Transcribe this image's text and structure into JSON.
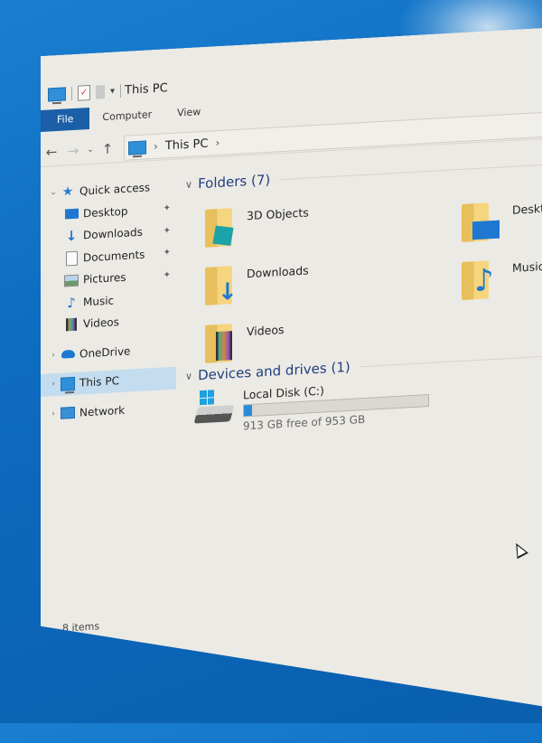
{
  "window": {
    "title": "This PC",
    "qat_dropdown_glyph": "▾"
  },
  "ribbon": {
    "tabs": [
      {
        "label": "File",
        "active": true
      },
      {
        "label": "Computer",
        "active": false
      },
      {
        "label": "View",
        "active": false
      }
    ]
  },
  "address": {
    "back_glyph": "←",
    "forward_glyph": "→",
    "recent_glyph": "⌄",
    "up_glyph": "↑",
    "sep_glyph": "›",
    "path": [
      "This PC"
    ]
  },
  "nav_pane": {
    "quick_access": {
      "label": "Quick access",
      "expanded_glyph": "⌄",
      "items": [
        {
          "label": "Desktop",
          "pinned": true,
          "icon": "desktop-icon"
        },
        {
          "label": "Downloads",
          "pinned": true,
          "icon": "downloads-icon"
        },
        {
          "label": "Documents",
          "pinned": true,
          "icon": "documents-icon"
        },
        {
          "label": "Pictures",
          "pinned": true,
          "icon": "pictures-icon"
        },
        {
          "label": "Music",
          "pinned": false,
          "icon": "music-icon"
        },
        {
          "label": "Videos",
          "pinned": false,
          "icon": "videos-icon"
        }
      ]
    },
    "roots": [
      {
        "label": "OneDrive",
        "icon": "onedrive-icon",
        "selected": false
      },
      {
        "label": "This PC",
        "icon": "this-pc-icon",
        "selected": true
      },
      {
        "label": "Network",
        "icon": "network-icon",
        "selected": false
      }
    ],
    "collapsed_glyph": "›",
    "pin_glyph": "📌"
  },
  "content": {
    "folders_header": "Folders (7)",
    "folders": [
      {
        "label": "3D Objects",
        "icon": "3d-objects-icon"
      },
      {
        "label": "Desktop",
        "icon": "desktop-folder-icon"
      },
      {
        "label": "Downloads",
        "icon": "downloads-folder-icon"
      },
      {
        "label": "Music",
        "icon": "music-folder-icon"
      },
      {
        "label": "Videos",
        "icon": "videos-folder-icon"
      }
    ],
    "drives_header": "Devices and drives (1)",
    "drives": [
      {
        "label": "Local Disk (C:)",
        "free_text": "913 GB free of 953 GB",
        "free_gb": 913,
        "total_gb": 953,
        "used_fraction": 0.042
      }
    ]
  },
  "status_bar": {
    "items_text": "8 items"
  },
  "colors": {
    "accent": "#1a5fa8",
    "selection": "#c4dcef",
    "drive_fill": "#2a8ad8",
    "desktop_bg": "#0d6bc0"
  }
}
